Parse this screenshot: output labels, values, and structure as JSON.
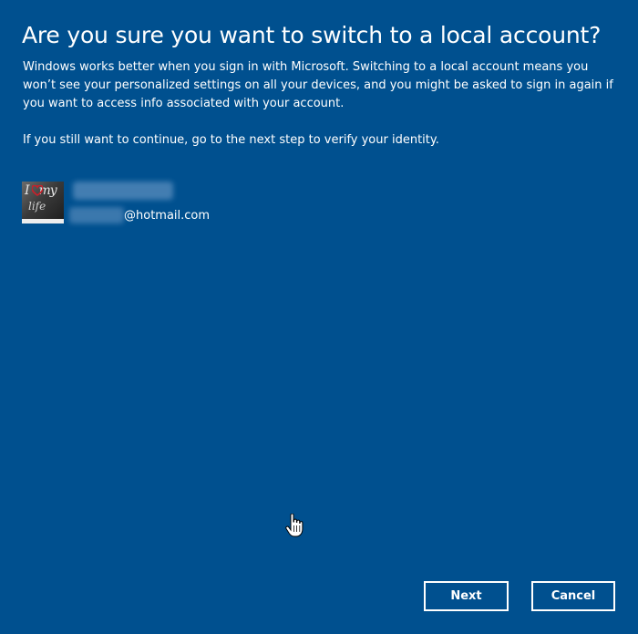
{
  "dialog": {
    "title": "Are you sure you want to switch to a local account?",
    "description": "Windows works better when you sign in with Microsoft. Switching to a local account means you won’t see your personalized settings on all your devices, and you might be asked to sign in again if you want to access info associated with your account.",
    "instruction": "If you still want to continue, go to the next step to verify your identity."
  },
  "account": {
    "avatar_text_line1": "I",
    "avatar_text_line1b": "my",
    "avatar_text_line2": "life",
    "name": "",
    "email_domain": "@hotmail.com"
  },
  "buttons": {
    "next_label": "Next",
    "cancel_label": "Cancel"
  },
  "colors": {
    "background": "#00508f",
    "text": "#ffffff",
    "button_border": "#ffffff",
    "heart": "#c8202a"
  },
  "icons": {
    "cursor": "hand-pointer-icon",
    "avatar_heart": "heart-icon"
  }
}
